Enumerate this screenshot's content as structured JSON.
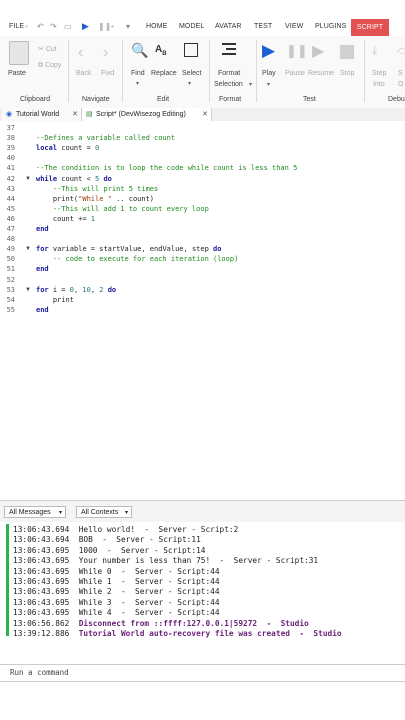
{
  "menu": {
    "items": [
      "FILE",
      "HOME",
      "MODEL",
      "AVATAR",
      "TEST",
      "VIEW",
      "PLUGINS",
      "SCRIPT"
    ],
    "active": "SCRIPT"
  },
  "ribbon": {
    "clipboard": {
      "paste": "Paste",
      "cut": "Cut",
      "copy": "Copy",
      "group": "Clipboard"
    },
    "navigate": {
      "back": "Back",
      "fwd": "Fwd",
      "group": "Navigate"
    },
    "edit": {
      "find": "Find",
      "replace": "Replace",
      "select": "Select",
      "group": "Edit"
    },
    "format": {
      "line1": "Format",
      "line2": "Selection",
      "group": "Format"
    },
    "test": {
      "play": "Play",
      "pause": "Pause",
      "resume": "Resume",
      "stop": "Stop",
      "group": "Test"
    },
    "debug": {
      "step_into_1": "Step",
      "step_into_2": "Into",
      "group": "Debu"
    }
  },
  "doc_tabs": [
    "Tutorial World",
    "Script* (DevWisezog Editing)"
  ],
  "editor": {
    "lines": [
      {
        "n": "37",
        "text": ""
      },
      {
        "n": "38",
        "text": "--Defines a variable called count"
      },
      {
        "n": "39",
        "text": "local count = 0"
      },
      {
        "n": "40",
        "text": ""
      },
      {
        "n": "41",
        "text": "--The condition is to loop the code while count is less than 5"
      },
      {
        "n": "42",
        "text": "while count < 5 do"
      },
      {
        "n": "43",
        "text": "    --This will print 5 times"
      },
      {
        "n": "44",
        "text": "    print(\"While \" .. count)"
      },
      {
        "n": "45",
        "text": "    --This will add 1 to count every loop"
      },
      {
        "n": "46",
        "text": "    count += 1"
      },
      {
        "n": "47",
        "text": "end"
      },
      {
        "n": "48",
        "text": ""
      },
      {
        "n": "49",
        "text": "for variable = startValue, endValue, step do"
      },
      {
        "n": "50",
        "text": "    -- code to execute for each iteration (loop)"
      },
      {
        "n": "51",
        "text": "end"
      },
      {
        "n": "52",
        "text": ""
      },
      {
        "n": "53",
        "text": "for i = 0, 10, 2 do"
      },
      {
        "n": "54",
        "text": "    print"
      },
      {
        "n": "55",
        "text": "end"
      }
    ]
  },
  "output": {
    "filter_messages": "All Messages",
    "filter_contexts": "All Contexts",
    "lines": [
      {
        "time": "13:06:43.694",
        "text": "Hello world!  -  Server - Script:2"
      },
      {
        "time": "13:06:43.694",
        "text": "BOB  -  Server - Script:11"
      },
      {
        "time": "13:06:43.695",
        "text": "1000  -  Server - Script:14"
      },
      {
        "time": "13:06:43.695",
        "text": "Your number is less than 75!  -  Server - Script:31"
      },
      {
        "time": "13:06:43.695",
        "text": "While 0  -  Server - Script:44"
      },
      {
        "time": "13:06:43.695",
        "text": "While 1  -  Server - Script:44"
      },
      {
        "time": "13:06:43.695",
        "text": "While 2  -  Server - Script:44"
      },
      {
        "time": "13:06:43.695",
        "text": "While 3  -  Server - Script:44"
      },
      {
        "time": "13:06:43.695",
        "text": "While 4  -  Server - Script:44"
      },
      {
        "time": "13:06:56.862",
        "text": "Disconnect from ::ffff:127.0.0.1|59272  -  Studio"
      },
      {
        "time": "13:39:12.886",
        "text": "Tutorial World auto-recovery file was created  -  Studio"
      }
    ]
  },
  "command_bar": {
    "placeholder": "Run a command"
  },
  "colors": {
    "accent": "#e35252",
    "output_bar": "#29b34a",
    "play_blue": "#1f5fd6"
  }
}
